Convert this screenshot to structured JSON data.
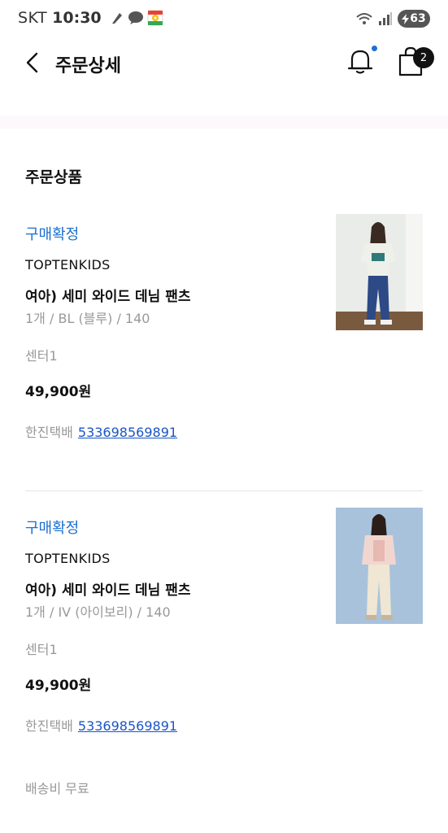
{
  "status_bar": {
    "carrier": "SKT",
    "time": "10:30",
    "battery": "63"
  },
  "header": {
    "title": "주문상세",
    "cart_count": "2"
  },
  "section": {
    "title": "주문상품"
  },
  "items": [
    {
      "status": "구매확정",
      "brand": "TOPTENKIDS",
      "name": "여아) 세미 와이드 데님 팬츠",
      "option": "1개 / BL (블루) / 140",
      "center": "센터1",
      "price": "49,900원",
      "courier": "한진택배",
      "tracking": "533698569891",
      "thumb_colors": {
        "bg": "#e9ece8",
        "top": "#eef0ea",
        "pants": "#2d4a86",
        "floor": "#7a5a3e"
      }
    },
    {
      "status": "구매확정",
      "brand": "TOPTENKIDS",
      "name": "여아) 세미 와이드 데님 팬츠",
      "option": "1개 / IV (아이보리) / 140",
      "center": "센터1",
      "price": "49,900원",
      "courier": "한진택배",
      "tracking": "533698569891",
      "thumb_colors": {
        "bg": "#a8c2dc",
        "top": "#f1d6cf",
        "pants": "#efe6d4",
        "floor": "#a8c2dc"
      }
    }
  ],
  "shipping": "배송비 무료",
  "colors": {
    "accent": "#1a6fd0",
    "link": "#1a55c4",
    "notification_dot": "#1e6fd9"
  }
}
